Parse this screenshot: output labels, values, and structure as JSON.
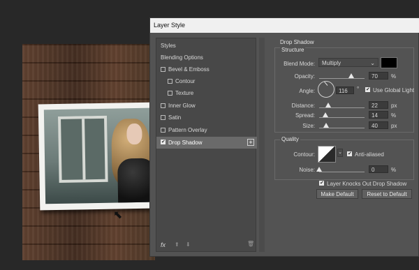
{
  "dialog": {
    "title": "Layer Style"
  },
  "styles_panel": {
    "header": "Styles",
    "blending_options": "Blending Options",
    "items": [
      {
        "label": "Bevel & Emboss",
        "checked": false
      },
      {
        "label": "Contour",
        "checked": false
      },
      {
        "label": "Texture",
        "checked": false
      },
      {
        "label": "Inner Glow",
        "checked": false
      },
      {
        "label": "Satin",
        "checked": false
      },
      {
        "label": "Pattern Overlay",
        "checked": false
      },
      {
        "label": "Drop Shadow",
        "checked": true
      }
    ],
    "fx_label": "fx"
  },
  "drop_shadow": {
    "title": "Drop Shadow",
    "structure": {
      "title": "Structure",
      "blend_mode_label": "Blend Mode:",
      "blend_mode_value": "Multiply",
      "shadow_color": "#000000",
      "opacity_label": "Opacity:",
      "opacity_value": "70",
      "opacity_unit": "%",
      "angle_label": "Angle:",
      "angle_value": "116",
      "angle_unit": "°",
      "use_global_light_label": "Use Global Light",
      "use_global_light": true,
      "distance_label": "Distance:",
      "distance_value": "22",
      "distance_unit": "px",
      "spread_label": "Spread:",
      "spread_value": "14",
      "spread_unit": "%",
      "size_label": "Size:",
      "size_value": "40",
      "size_unit": "px"
    },
    "quality": {
      "title": "Quality",
      "contour_label": "Contour:",
      "anti_aliased_label": "Anti-aliased",
      "anti_aliased": true,
      "noise_label": "Noise:",
      "noise_value": "0",
      "noise_unit": "%"
    },
    "knockout_label": "Layer Knocks Out Drop Shadow",
    "knockout": true,
    "make_default_label": "Make Default",
    "reset_default_label": "Reset to Default"
  }
}
